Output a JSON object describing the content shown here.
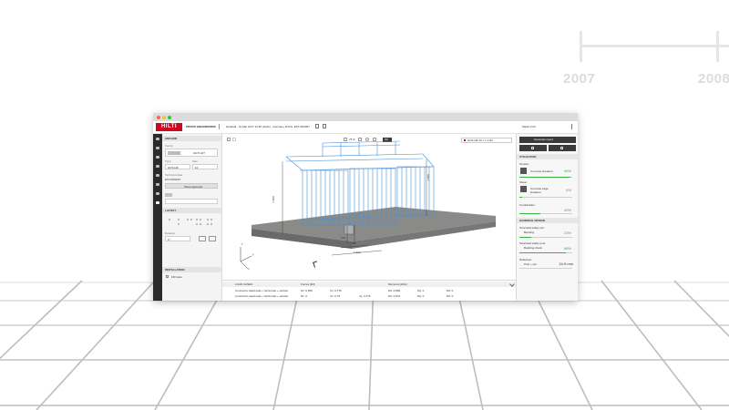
{
  "timeline": {
    "years": [
      "2007",
      "2008"
    ]
  },
  "app": {
    "logo_text": "HILTI",
    "product_name": "PROFIS ENGINEERING",
    "project_info": "Handrail · 31 Mar 2017 12:38 (Hello) · Germany, ETAG, ETA 06/0097",
    "user_name": "Martin Fritz"
  },
  "left_panel": {
    "section_anchor": "ANCHOR",
    "family_label": "Family",
    "family_value": "HILTI-HIT",
    "type_value": "HUS-HR",
    "type_label": "Type",
    "size_label": "Size",
    "size_value": "10",
    "approval_label": "Technical data",
    "approval_value": "ETA 06/0097",
    "more_button": "Show approval",
    "layout_section": "LAYOUT",
    "rotation_label": "Rotation",
    "rotation_value": "0 °",
    "installation_section": "INSTALLATION",
    "fill_holes_label": "Fill holes"
  },
  "viewport": {
    "zoom_value": "75 %",
    "mode_label": "3D",
    "load_dropdown": "HUS-HR 10 x 1 units",
    "dims": [
      "1.200",
      "800",
      "1.000",
      "1.050",
      "120"
    ],
    "axis_labels": [
      "z",
      "y",
      "x"
    ]
  },
  "table": {
    "headers": [
      "LOAD CASES",
      "Forces [kN]",
      "",
      "",
      "Moments [kNm]",
      "",
      ""
    ],
    "rows": [
      [
        "Concentric dead load + horizontal + vertical",
        "Nz: 0,659",
        "Vx: 0,776",
        "",
        "Mx: 0,883",
        "My: 0",
        "Mz: 0"
      ],
      [
        "Concentric dead load + horizontal + vertical",
        "Nz: 0",
        "Vx: 0,75",
        "Vy: 0,776",
        "Mx: 0,872",
        "My: 0",
        "Mz: 0"
      ]
    ]
  },
  "right_panel": {
    "generate_report": "Generate report",
    "utilization_section": "UTILIZATION",
    "tension_label": "Tension",
    "tension_item": "Concrete breakout",
    "tension_pct": "96%",
    "tension_value": 0.96,
    "shear_label": "Shear",
    "shear_item": "Concrete edge breakout",
    "shear_pct": "6%",
    "shear_value": 0.06,
    "combination_label": "Combination",
    "combination_pct": "40%",
    "combination_value": 0.4,
    "handrail_section": "HANDRAIL DESIGN",
    "struct_post_label": "Structural safety rail",
    "bending_label": "Bending",
    "bending_pct": "23%",
    "bending_value": 0.23,
    "struct_post2_label": "Structural safety post",
    "buckling_label": "Buckling check",
    "buckling_pct": "88%",
    "buckling_value": 0.88,
    "deflection_label": "Deflection",
    "post_rail_label": "Post + rail",
    "deflection_value": "24.9 mm"
  },
  "colors": {
    "brand": "#d2051e",
    "ok_green": "#3cb043",
    "rail_dark": "#2a2a2a",
    "mesh_blue": "#4a8fd8"
  }
}
